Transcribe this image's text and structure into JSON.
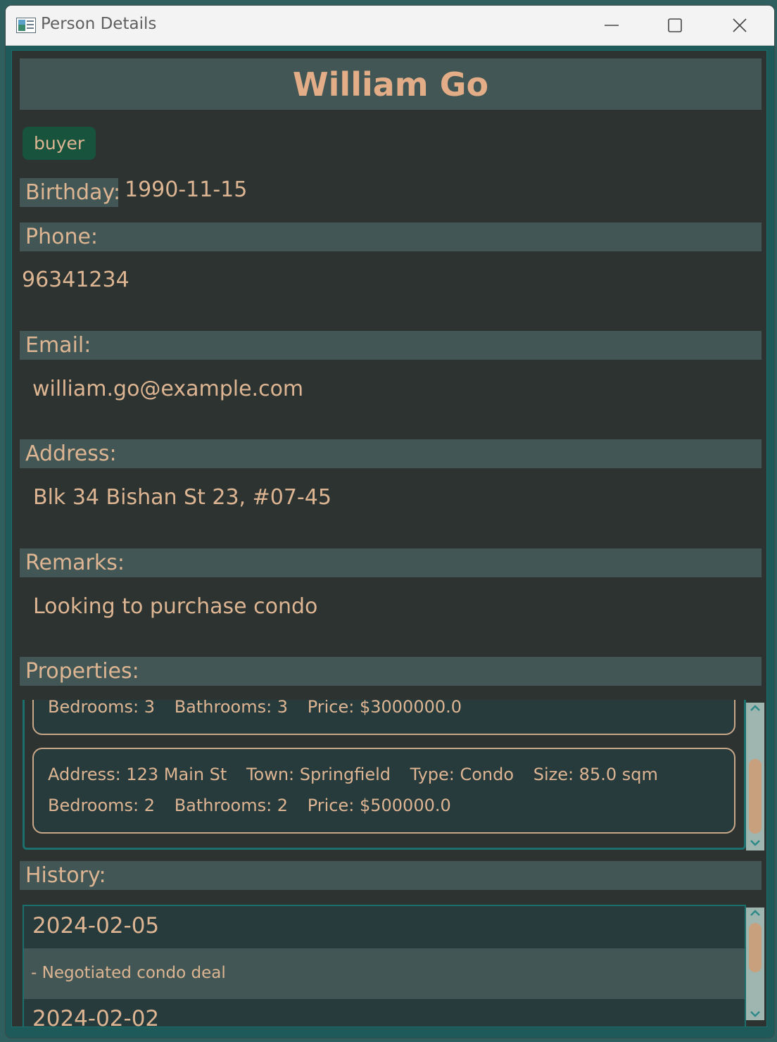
{
  "window": {
    "title": "Person Details"
  },
  "person": {
    "name": "William Go",
    "tag": "buyer",
    "birthday_label": "Birthday:",
    "birthday": "1990-11-15",
    "phone_label": "Phone:",
    "phone": "96341234",
    "email_label": "Email:",
    "email": "william.go@example.com",
    "address_label": "Address:",
    "address": "Blk 34 Bishan St 23, #07-45",
    "remarks_label": "Remarks:",
    "remarks": "Looking to purchase condo"
  },
  "properties": {
    "label": "Properties:",
    "items": [
      {
        "bedrooms": "Bedrooms: 3",
        "bathrooms": "Bathrooms: 3",
        "price": "Price: $3000000.0"
      },
      {
        "address": "Address: 123 Main St",
        "town": "Town: Springfield",
        "type": "Type: Condo",
        "size": "Size: 85.0 sqm",
        "bedrooms": "Bedrooms: 2",
        "bathrooms": "Bathrooms: 2",
        "price": "Price: $500000.0"
      }
    ],
    "scroll_position": 0.75
  },
  "history": {
    "label": "History:",
    "entries": [
      {
        "date": "2024-02-05",
        "note": "- Negotiated condo deal"
      },
      {
        "date": "2024-02-02"
      }
    ],
    "scroll_position": 0.1
  },
  "colors": {
    "accent_text": "#ddb592",
    "panel": "#425755",
    "background": "#2c3331",
    "tag": "#18533d",
    "border": "#1b6f6d"
  }
}
